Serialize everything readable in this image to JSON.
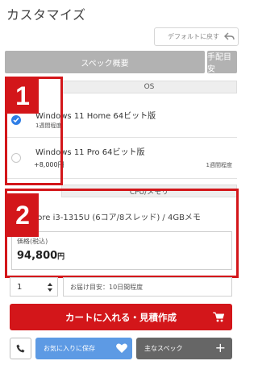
{
  "page": {
    "title": "カスタマイズ"
  },
  "toolbar": {
    "default_label": "デフォルトに戻す"
  },
  "tabs": [
    {
      "label": "スペック概要"
    },
    {
      "label": "手配目安"
    }
  ],
  "sections": {
    "os": "OS",
    "cpu": "CPU/メモリ"
  },
  "os_options": [
    {
      "name": "Windows 11 Home 64ビット版",
      "sub": "1週間程度",
      "selected": true
    },
    {
      "name": "Windows 11 Pro 64ビット版",
      "price": "+8,000円",
      "sub": "1週間程度",
      "selected": false
    }
  ],
  "markers": {
    "one": "1",
    "two": "2"
  },
  "cpu": {
    "line": "Intel Core i3-1315U (6コア/8スレッド) / 4GBメモ"
  },
  "price": {
    "label": "価格(税込)",
    "amount": "94,800",
    "unit": "円"
  },
  "order": {
    "quantity": "1",
    "delivery": "お届け目安：10日間程度"
  },
  "actions": {
    "cart": "カートに入れる・見積作成",
    "favorite": "お気に入りに保存",
    "spec": "主なスペック",
    "plus": "+"
  },
  "colors": {
    "accent_red": "#d3161a",
    "check_blue": "#2f7ee6",
    "favorite_blue": "#5d9ae4",
    "tab_gray": "#b2b2b2",
    "spec_gray": "#666666"
  },
  "icons": [
    "undo-icon",
    "check-icon",
    "sort-arrows-icon",
    "cart-icon",
    "phone-icon",
    "heart-icon"
  ]
}
